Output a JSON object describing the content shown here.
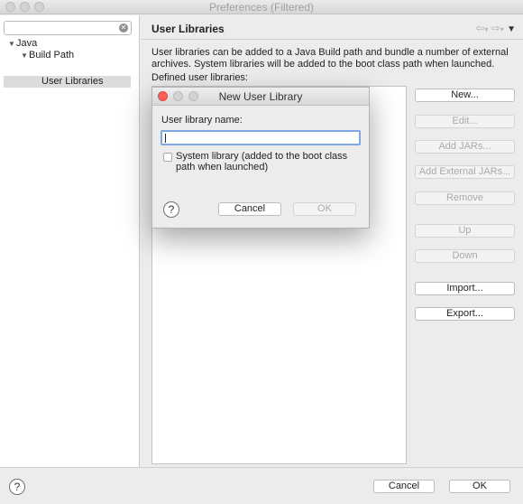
{
  "window": {
    "title": "Preferences (Filtered)"
  },
  "sidebar": {
    "filter_clear_icon": "clear-icon",
    "tree": [
      {
        "label": "Java",
        "expanded": true,
        "level": 0
      },
      {
        "label": "Build Path",
        "expanded": true,
        "level": 1
      },
      {
        "label": "User Libraries",
        "selected": true,
        "level": 2
      }
    ]
  },
  "page": {
    "title": "User Libraries",
    "description": "User libraries can be added to a Java Build path and bundle a number of external archives. System libraries will be added to the boot class path when launched.",
    "defined_label": "Defined user libraries:",
    "nav": {
      "back": "⇦",
      "back_menu": "▾",
      "forward": "⇨",
      "forward_menu": "▾",
      "view_menu": "▼"
    }
  },
  "buttons": {
    "new": "New...",
    "edit": "Edit...",
    "add_jars": "Add JARs...",
    "add_external_jars": "Add External JARs...",
    "remove": "Remove",
    "up": "Up",
    "down": "Down",
    "import": "Import...",
    "export": "Export..."
  },
  "bottom": {
    "help": "?",
    "cancel": "Cancel",
    "ok": "OK"
  },
  "dialog": {
    "title": "New User Library",
    "name_label": "User library name:",
    "name_value": "",
    "system_library_label": "System library (added to the boot class path when launched)",
    "system_library_checked": false,
    "help": "?",
    "cancel": "Cancel",
    "ok": "OK",
    "colors": {
      "close": "#fc605b",
      "minimize": "#d3d3d3",
      "zoom": "#d3d3d3",
      "focus_ring": "#80a7e1"
    }
  }
}
